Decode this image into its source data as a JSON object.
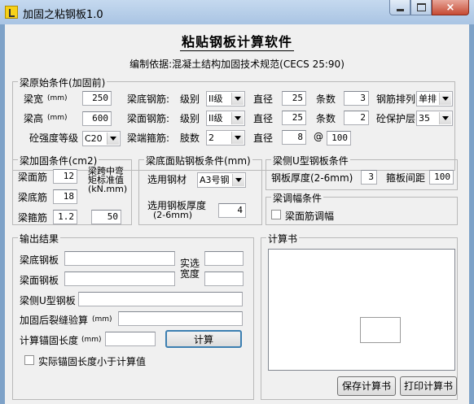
{
  "window": {
    "title": "加固之粘钢板1.0",
    "close_glyph": "×"
  },
  "heading": "粘贴钢板计算软件",
  "basis": "编制依据:混凝土结构加固技术规范(CECS 25:90)",
  "beam_original": {
    "legend": "梁原始条件(加固前)",
    "width_label": "梁宽",
    "height_label": "梁高",
    "mm": "(mm)",
    "width": "250",
    "height": "600",
    "concrete_label": "砼强度等级",
    "concrete": "C20",
    "bottom_rebar_label": "梁底钢筋:",
    "top_rebar_label": "梁面钢筋:",
    "stirrup_label": "梁端箍筋:",
    "grade_label": "级别",
    "diameter_label": "直径",
    "count_label": "条数",
    "legs_label": "肢数",
    "bottom_grade": "II级",
    "bottom_dia": "25",
    "bottom_count": "3",
    "top_grade": "II级",
    "top_dia": "25",
    "top_count": "2",
    "stirrup_legs": "2",
    "stirrup_dia": "8",
    "at": "@",
    "stirrup_spacing": "100",
    "arrangement_label": "钢筋排列",
    "arrangement": "单排",
    "cover_label": "砼保护层",
    "cover": "35"
  },
  "reinforced": {
    "legend": "梁加固条件(cm2)",
    "top_label": "梁面筋",
    "top": "12",
    "bottom_label": "梁底筋",
    "bottom": "18",
    "stirrup_label": "梁箍筋",
    "stirrup": "1.2",
    "midspan_label": "梁跨中弯矩标准值(kN.mm)",
    "midspan": "50"
  },
  "bottom_plate": {
    "legend": "梁底面贴钢板条件(mm)",
    "steel_label": "选用钢材",
    "steel": "A3号钢",
    "thickness_label": "选用钢板厚度",
    "thickness_range": "(2-6mm)",
    "thickness": "4"
  },
  "side_plate": {
    "legend": "梁侧U型钢板条件",
    "thickness_label": "钢板厚度(2-6mm)",
    "thickness": "3",
    "spacing_label": "箍板间距",
    "spacing": "100"
  },
  "adjust": {
    "legend": "梁调幅条件",
    "checkbox_label": "梁面筋调幅"
  },
  "output": {
    "legend": "输出结果",
    "bottom_plate_label": "梁底钢板",
    "top_plate_label": "梁面钢板",
    "actual_width_label": "实选宽度",
    "side_u_label": "梁侧U型钢板",
    "crack_label": "加固后裂缝验算",
    "crack_unit": "(mm)",
    "anchor_label": "计算锚固长度",
    "anchor_unit": "(mm)",
    "calc_button": "计算",
    "anchor_check_label": "实际锚固长度小于计算值"
  },
  "calc_book": {
    "legend": "计算书",
    "save_button": "保存计算书",
    "print_button": "打印计算书"
  }
}
